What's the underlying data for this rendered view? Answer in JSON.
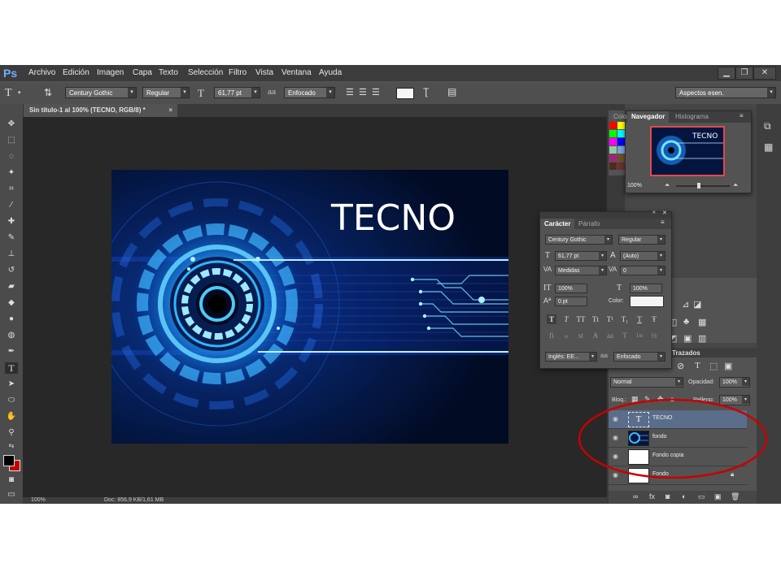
{
  "app": {
    "logo": "Ps"
  },
  "menu": [
    "Archivo",
    "Edición",
    "Imagen",
    "Capa",
    "Texto",
    "Selección",
    "Filtro",
    "Vista",
    "Ventana",
    "Ayuda"
  ],
  "options": {
    "tool_glyph": "T",
    "font_family": "Century Gothic",
    "font_style": "Regular",
    "font_size": "61,77 pt",
    "antialias_prefix": "a",
    "antialias": "Enfocado",
    "workspace": "Aspectos esen."
  },
  "document": {
    "tab_title": "Sin título-1 al 100% (TECNO, RGB/8) *",
    "close_glyph": "×"
  },
  "canvas": {
    "headline": "TECNO"
  },
  "status": {
    "zoom": "100%",
    "doc_info": "Doc: 856,9 KB/1,61 MB"
  },
  "navigator": {
    "tab_color": "Colo",
    "tab_active": "Navegador",
    "tab_histogram": "Histograma",
    "thumb_text": "TECNO",
    "zoom": "100%"
  },
  "character": {
    "tab_active": "Carácter",
    "tab_paragraph": "Párrafo",
    "font_family": "Century Gothic",
    "font_style": "Regular",
    "size": "61,77 pt",
    "leading": "(Auto)",
    "kerning": "Medidas",
    "tracking": "0",
    "vscale": "100%",
    "hscale": "100%",
    "baseline": "0 pt",
    "color_label": "Color:",
    "style_buttons": [
      "T",
      "T",
      "TT",
      "Tt",
      "T¹",
      "T₁",
      "T",
      "Ŧ"
    ],
    "ot_buttons": [
      "fi",
      "ℴ",
      "st",
      "A",
      "aa",
      "T",
      "1st",
      "½"
    ],
    "language": "Inglés: EE...",
    "aa_prefix": "a",
    "antialias": "Enfocado"
  },
  "layers_panel": {
    "paths_tab": "Trazados",
    "blend_mode": "Normal",
    "opacity_label": "Opacidad:",
    "opacity": "100%",
    "lock_label": "Bloq.:",
    "fill_label": "Relleno:",
    "fill": "100%"
  },
  "layers": [
    {
      "name": "TECNO",
      "type": "text",
      "selected": true
    },
    {
      "name": "fondo",
      "type": "image",
      "selected": false
    },
    {
      "name": "Fondo copia",
      "type": "white",
      "selected": false
    },
    {
      "name": "Fondo",
      "type": "white",
      "locked": true,
      "selected": false
    }
  ],
  "annotation": {
    "color": "#c80000"
  },
  "colors": {
    "accent": "#0a74ff",
    "canvas_bg": "#020c2a",
    "panel": "#535353",
    "menubar": "#3c3c3c"
  }
}
